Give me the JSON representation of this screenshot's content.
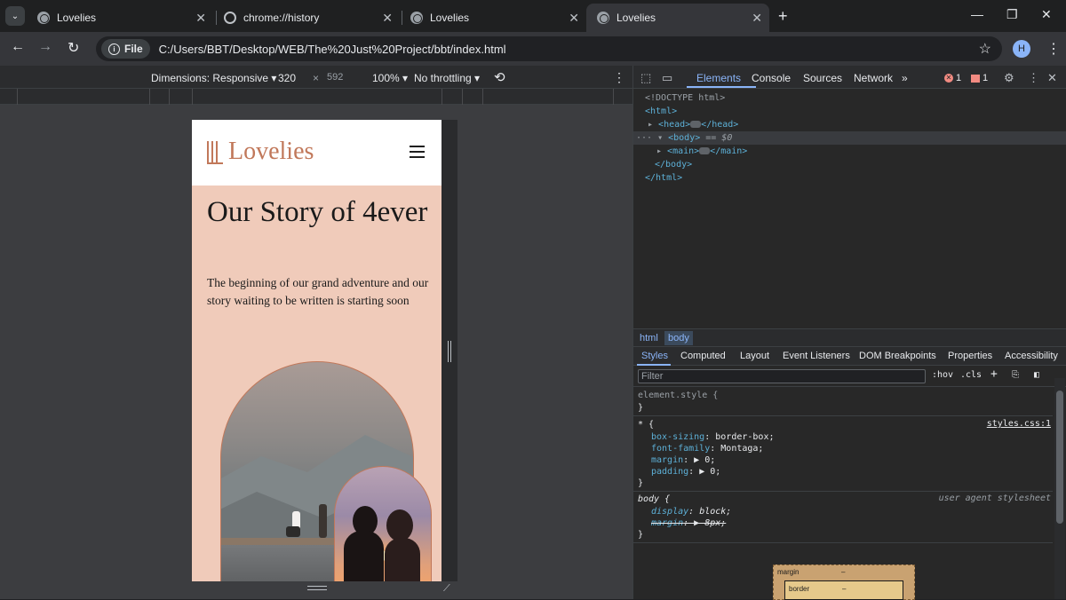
{
  "tabs": [
    {
      "title": "Lovelies",
      "active": false
    },
    {
      "title": "chrome://history",
      "active": false
    },
    {
      "title": "Lovelies",
      "active": false
    },
    {
      "title": "Lovelies",
      "active": true
    }
  ],
  "toolbar": {
    "chip_label": "File",
    "url": "C:/Users/BBT/Desktop/WEB/The%20Just%20Project/bbt/index.html",
    "profile_initial": "H"
  },
  "device_toolbar": {
    "dimensions": "Dimensions: Responsive",
    "width": "320",
    "times": "×",
    "height": "592",
    "zoom": "100%",
    "throttling": "No throttling"
  },
  "site": {
    "logo_text": "Lovelies",
    "hero_title": "Our Story of 4ever",
    "hero_text": "The beginning of our grand adventure and our story waiting to be written is starting soon"
  },
  "devtools": {
    "tabs": [
      "Elements",
      "Console",
      "Sources",
      "Network"
    ],
    "more_tabs": "»",
    "errors_count": "1",
    "issues_count": "1",
    "dom": {
      "doctype": "<!DOCTYPE html>",
      "html_open": "<html>",
      "head": "<head>",
      "head_close": "</head>",
      "body_open": "<body>",
      "body_marker": "== $0",
      "main": "<main>",
      "main_close": "</main>",
      "body_close": "</body>",
      "html_close": "</html>"
    },
    "breadcrumbs": [
      "html",
      "body"
    ],
    "style_tabs": [
      "Styles",
      "Computed",
      "Layout",
      "Event Listeners",
      "DOM Breakpoints",
      "Properties",
      "Accessibility"
    ],
    "filter_placeholder": "Filter",
    "hov": ":hov",
    "cls": ".cls",
    "rules": {
      "element_style": "element.style {",
      "brace_close": "}",
      "universal_selector": "* {",
      "universal_source": "styles.css:1",
      "universal_props": [
        {
          "name": "box-sizing",
          "value": "border-box;"
        },
        {
          "name": "font-family",
          "value": "Montaga;"
        },
        {
          "name": "margin",
          "value": "▶ 0;"
        },
        {
          "name": "padding",
          "value": "▶ 0;"
        }
      ],
      "body_selector": "body {",
      "body_source": "user agent stylesheet",
      "body_props": [
        {
          "name": "display",
          "value": "block;"
        },
        {
          "name": "margin",
          "value": "▶ 8px;"
        }
      ]
    },
    "box_model": {
      "margin_label": "margin",
      "margin_value": "–",
      "border_label": "border",
      "border_value": "–"
    }
  }
}
